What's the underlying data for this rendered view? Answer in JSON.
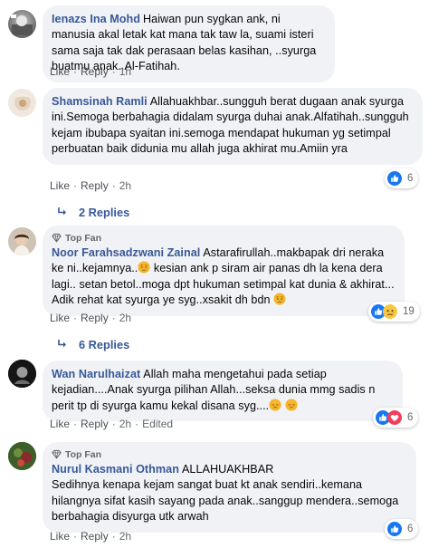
{
  "colors": {
    "link": "#385898",
    "meta": "#65676b",
    "bubble": "#f0f2f5",
    "like": "#1877f2"
  },
  "actions": {
    "like": "Like",
    "reply": "Reply",
    "sep": "·"
  },
  "comments": [
    {
      "author": "Ienazs Ina Mohd",
      "top_fan": "",
      "text": "Haiwan pun sygkan ank, ni manusia akal letak kat mana tak taw la, suami isteri sama saja tak dak perasaan belas kasihan, ..syurga buatmu anak..Al-Fatihah.",
      "time": "1h",
      "edited": "",
      "reactions": "",
      "replies": ""
    },
    {
      "author": "Shamsinah Ramli",
      "top_fan": "",
      "text": "Allahuakhbar..sungguh berat dugaan anak syurga ini.Semoga berbahagia didalam syurga duhai anak.Alfatihah..sungguh kejam ibubapa syaitan ini.semoga mendapat hukuman yg setimpal perbuatan baik didunia mu allah juga akhirat mu.Amiin yra",
      "time": "2h",
      "edited": "",
      "reactions": "6",
      "replies": "2 Replies"
    },
    {
      "author": "Noor Farahsadzwani Zainal",
      "top_fan": "Top Fan",
      "text_a": "Astarafirullah..makbapak dri neraka ke ni..kejamnya..",
      "text_b": " kesian ank p siram air panas dh la kena dera lagi.. setan betol..moga dpt hukuman setimpal kat dunia & akhirat... Adik rehat kat syurga ye syg..xsakit dh bdn ",
      "time": "2h",
      "edited": "",
      "reactions": "19",
      "replies": "6 Replies"
    },
    {
      "author": "Wan Narulhaizat",
      "top_fan": "",
      "text": "Allah maha mengetahui pada setiap kejadian....Anak syurga pilihan Allah...seksa dunia mmg sadis n perit tp di syurga kamu kekal disana syg....",
      "time": "2h",
      "edited": "Edited",
      "reactions": "6",
      "replies": ""
    },
    {
      "author": "Nurul Kasmani Othman",
      "top_fan": "Top Fan",
      "text_a": "ALLAHUAKHBAR",
      "text_b": "Sedihnya kenapa kejam sangat buat kt anak sendiri..kemana hilangnya sifat kasih sayang pada anak..sanggup mendera..semoga berbahagia disyurga utk arwah",
      "time": "2h",
      "edited": "",
      "reactions": "6",
      "replies": ""
    }
  ]
}
